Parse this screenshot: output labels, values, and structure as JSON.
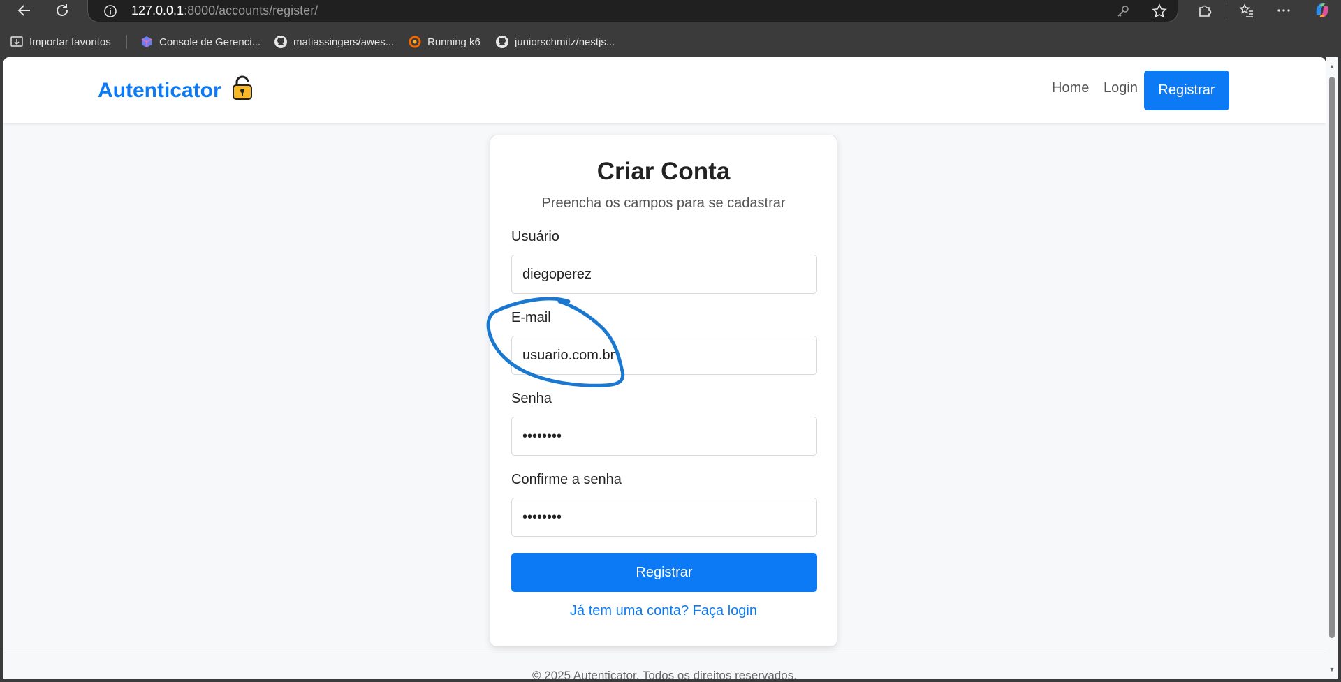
{
  "browser": {
    "url_host": "127.0.0.1",
    "url_rest": ":8000/accounts/register/",
    "bookmarks": [
      {
        "label": "Importar favoritos",
        "icon": "import-favorites-icon"
      },
      {
        "label": "Console de Gerenci...",
        "icon": "cube-icon"
      },
      {
        "label": "matiassingers/awes...",
        "icon": "github-icon"
      },
      {
        "label": "Running k6",
        "icon": "grafana-icon"
      },
      {
        "label": "juniorschmitz/nestjs...",
        "icon": "github-icon"
      }
    ]
  },
  "navbar": {
    "brand": "Autenticator",
    "links": [
      "Home",
      "Login"
    ],
    "register_button": "Registrar"
  },
  "form": {
    "title": "Criar Conta",
    "subtitle": "Preencha os campos para se cadastrar",
    "username_label": "Usuário",
    "username_value": "diegoperez",
    "email_label": "E-mail",
    "email_value": "usuario.com.br",
    "password_label": "Senha",
    "password_value": "••••••••",
    "confirm_label": "Confirme a senha",
    "confirm_value": "••••••••",
    "submit": "Registrar",
    "login_link": "Já tem uma conta? Faça login"
  },
  "footer": {
    "text": "© 2025 Autenticator. Todos os direitos reservados."
  },
  "colors": {
    "accent": "#0d7af5",
    "annotation": "#1a78d0"
  }
}
